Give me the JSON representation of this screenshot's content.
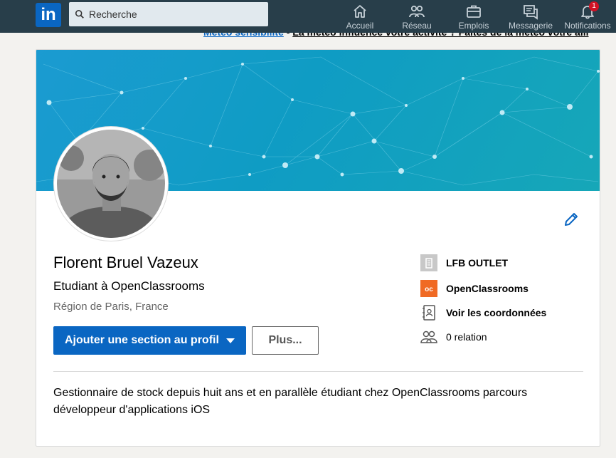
{
  "nav": {
    "logo": "in",
    "search_placeholder": "Recherche",
    "items": [
      {
        "label": "Accueil",
        "icon": "home-icon"
      },
      {
        "label": "Réseau",
        "icon": "network-icon"
      },
      {
        "label": "Emplois",
        "icon": "briefcase-icon"
      },
      {
        "label": "Messagerie",
        "icon": "messaging-icon"
      },
      {
        "label": "Notifications",
        "icon": "bell-icon",
        "badge": "1"
      }
    ]
  },
  "announcement": {
    "link": "Météo sensibilité",
    "separator": " - ",
    "text": "La météo influence votre activité ? Faites de la météo votre alli"
  },
  "profile": {
    "name": "Florent Bruel Vazeux",
    "headline": "Etudiant à OpenClassrooms",
    "location": "Région de Paris, France",
    "add_section_button": "Ajouter une section au profil",
    "more_button": "Plus...",
    "side": [
      {
        "label": "LFB OUTLET",
        "icon": "company-placeholder-icon"
      },
      {
        "label": "OpenClassrooms",
        "icon": "openclassrooms-logo-icon"
      },
      {
        "label": "Voir les coordonnées",
        "icon": "contact-card-icon"
      },
      {
        "label": "0 relation",
        "icon": "people-icon"
      }
    ],
    "summary": "Gestionnaire de stock depuis huit ans et en parallèle étudiant chez OpenClassrooms parcours développeur d'applications iOS"
  },
  "colors": {
    "nav_bg": "#283e4a",
    "brand": "#0a66c2",
    "openclassrooms": "#f06a24"
  }
}
